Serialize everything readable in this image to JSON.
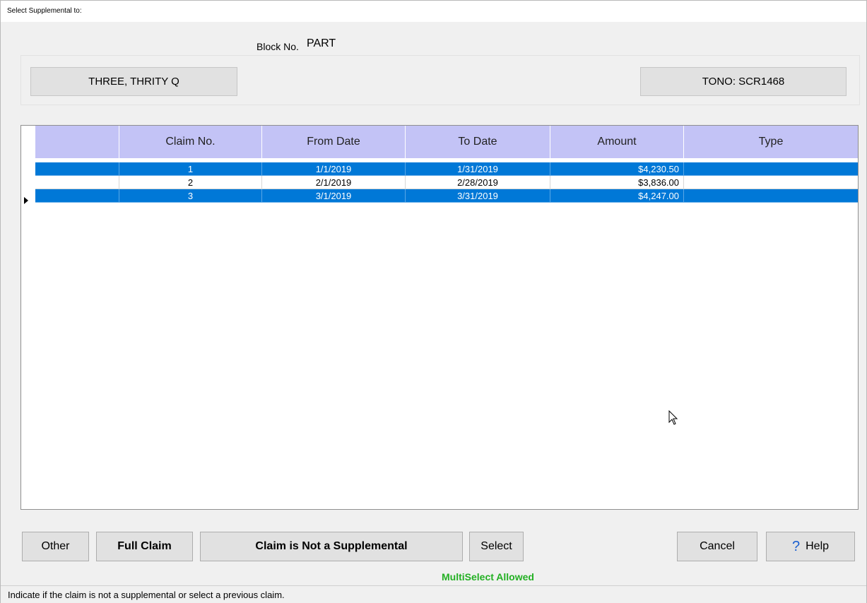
{
  "window": {
    "title": "Select Supplemental to:"
  },
  "block": {
    "label": "Block No.",
    "value": "PART"
  },
  "patient_button": "THREE, THRITY Q",
  "tono_button": "TONO: SCR1468",
  "grid": {
    "columns": [
      "",
      "Claim No.",
      "From Date",
      "To Date",
      "Amount",
      "Type"
    ],
    "rows": [
      {
        "claim_no": "1",
        "from": "1/1/2019",
        "to": "1/31/2019",
        "amount": "$4,230.50",
        "type": "",
        "selected": true
      },
      {
        "claim_no": "2",
        "from": "2/1/2019",
        "to": "2/28/2019",
        "amount": "$3,836.00",
        "type": "",
        "selected": false
      },
      {
        "claim_no": "3",
        "from": "3/1/2019",
        "to": "3/31/2019",
        "amount": "$4,247.00",
        "type": "",
        "selected": true
      }
    ]
  },
  "buttons": {
    "other": "Other",
    "full_claim": "Full Claim",
    "not_supplemental": "Claim is Not a Supplemental",
    "select": "Select",
    "cancel": "Cancel",
    "help": "Help"
  },
  "multiselect_text": "MultiSelect Allowed",
  "status_text": "Indicate if the claim is not a supplemental or select a previous claim.",
  "icons": {
    "help": "question-mark-icon",
    "cursor": "mouse-pointer-icon",
    "row_indicator": "row-arrow-icon"
  },
  "colors": {
    "header_bg": "#c3c3f6",
    "selection": "#0078d7",
    "multiselect": "#23b023"
  }
}
